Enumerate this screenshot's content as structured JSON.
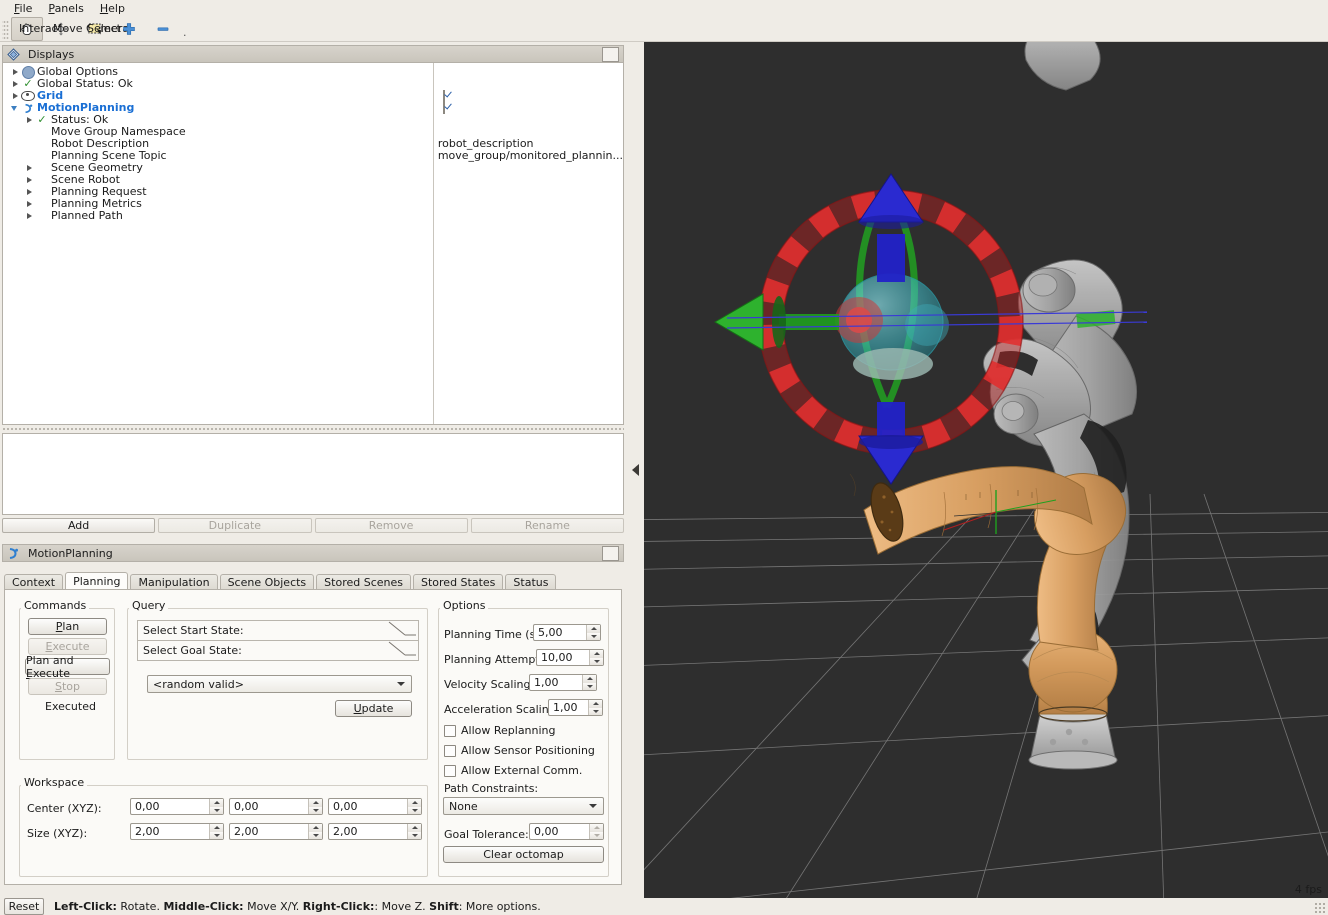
{
  "menubar": {
    "items": [
      {
        "label": "File",
        "mnemonic": "F"
      },
      {
        "label": "Panels",
        "mnemonic": "P"
      },
      {
        "label": "Help",
        "mnemonic": "H"
      }
    ]
  },
  "toolbar": {
    "buttons": [
      {
        "label": "Interact",
        "icon": "hand-icon",
        "active": true
      },
      {
        "label": "Move Camera",
        "icon": "move-camera-icon",
        "active": false
      },
      {
        "label": "Select",
        "icon": "select-rectangle-icon",
        "active": false
      },
      {
        "label": "",
        "icon": "plus-icon",
        "active": false
      },
      {
        "label": "",
        "icon": "minus-icon",
        "active": false
      }
    ]
  },
  "displays": {
    "title": "Displays",
    "tree": [
      {
        "label": "Global Options",
        "indent": 0,
        "expander": "right",
        "icon": "globe-icon",
        "value": ""
      },
      {
        "label": "Global Status: Ok",
        "indent": 0,
        "expander": "right",
        "icon": "check-icon",
        "value": ""
      },
      {
        "label": "Grid",
        "indent": 0,
        "expander": "right",
        "icon": "eye-icon",
        "value": "checkbox",
        "highlight": true
      },
      {
        "label": "MotionPlanning",
        "indent": 0,
        "expander": "down",
        "icon": "motion-planning-icon",
        "value": "checkbox",
        "highlight": true
      },
      {
        "label": "Status: Ok",
        "indent": 1,
        "expander": "right",
        "icon": "check-icon",
        "value": ""
      },
      {
        "label": "Move Group Namespace",
        "indent": 1,
        "expander": "none",
        "icon": "none",
        "value": ""
      },
      {
        "label": "Robot Description",
        "indent": 1,
        "expander": "none",
        "icon": "none",
        "value": "robot_description"
      },
      {
        "label": "Planning Scene Topic",
        "indent": 1,
        "expander": "none",
        "icon": "none",
        "value": "move_group/monitored_plannin..."
      },
      {
        "label": "Scene Geometry",
        "indent": 1,
        "expander": "right",
        "icon": "none",
        "value": ""
      },
      {
        "label": "Scene Robot",
        "indent": 1,
        "expander": "right",
        "icon": "none",
        "value": ""
      },
      {
        "label": "Planning Request",
        "indent": 1,
        "expander": "right",
        "icon": "none",
        "value": ""
      },
      {
        "label": "Planning Metrics",
        "indent": 1,
        "expander": "right",
        "icon": "none",
        "value": ""
      },
      {
        "label": "Planned Path",
        "indent": 1,
        "expander": "right",
        "icon": "none",
        "value": ""
      }
    ],
    "buttons": [
      {
        "label": "Add",
        "enabled": true
      },
      {
        "label": "Duplicate",
        "enabled": false
      },
      {
        "label": "Remove",
        "enabled": false
      },
      {
        "label": "Rename",
        "enabled": false
      }
    ]
  },
  "motion_planning": {
    "title": "MotionPlanning",
    "tabs": [
      {
        "label": "Context",
        "selected": false
      },
      {
        "label": "Planning",
        "selected": true
      },
      {
        "label": "Manipulation",
        "selected": false
      },
      {
        "label": "Scene Objects",
        "selected": false
      },
      {
        "label": "Stored Scenes",
        "selected": false
      },
      {
        "label": "Stored States",
        "selected": false
      },
      {
        "label": "Status",
        "selected": false
      }
    ],
    "commands": {
      "legend": "Commands",
      "buttons": [
        {
          "label": "Plan",
          "mnemonic": "P",
          "enabled": true
        },
        {
          "label": "Execute",
          "mnemonic": "E",
          "enabled": false
        },
        {
          "label": "Plan and Execute",
          "mnemonic": "E",
          "enabled": true
        },
        {
          "label": "Stop",
          "mnemonic": "S",
          "enabled": false
        }
      ],
      "status": "Executed"
    },
    "query": {
      "legend": "Query",
      "start_state_label": "Select Start State:",
      "goal_state_label": "Select Goal State:",
      "goal_state_value": "<random valid>",
      "update_label": "Update"
    },
    "options": {
      "legend": "Options",
      "fields": [
        {
          "label": "Planning Time (s):",
          "value": "5,00"
        },
        {
          "label": "Planning Attempts:",
          "value": "10,00"
        },
        {
          "label": "Velocity Scaling:",
          "value": "1,00"
        },
        {
          "label": "Acceleration Scaling:",
          "value": "1,00"
        }
      ],
      "checkboxes": [
        {
          "label": "Allow Replanning",
          "checked": false
        },
        {
          "label": "Allow Sensor Positioning",
          "checked": false
        },
        {
          "label": "Allow External Comm.",
          "checked": false
        }
      ],
      "path_constraints_label": "Path Constraints:",
      "path_constraints_value": "None",
      "goal_tolerance_label": "Goal Tolerance:",
      "goal_tolerance_value": "0,00",
      "clear_octomap_label": "Clear octomap"
    },
    "workspace": {
      "legend": "Workspace",
      "rows": [
        {
          "label": "Center (XYZ):",
          "values": [
            "0,00",
            "0,00",
            "0,00"
          ]
        },
        {
          "label": "Size (XYZ):",
          "values": [
            "2,00",
            "2,00",
            "2,00"
          ]
        }
      ]
    }
  },
  "viewport": {
    "fps": "4 fps",
    "background_color": "#2e2e2e",
    "grid_color": "#8d8d8d",
    "marker": {
      "ring_color": "#c42020",
      "z_arrow_color": "#2222c8",
      "y_arrow_color": "#22a022",
      "sphere_color": "#3fb8c4",
      "x_sphere_color": "#cc3333"
    },
    "robot": {
      "goal_color": "#d9a066",
      "current_color": "#b5b5b5"
    }
  },
  "statusbar": {
    "reset_label": "Reset",
    "hints": [
      {
        "bold": "Left-Click:",
        "text": " Rotate. "
      },
      {
        "bold": "Middle-Click:",
        "text": " Move X/Y. "
      },
      {
        "bold": "Right-Click:",
        "text": ": Move Z. "
      },
      {
        "bold": "Shift",
        "text": ": More options."
      }
    ]
  }
}
